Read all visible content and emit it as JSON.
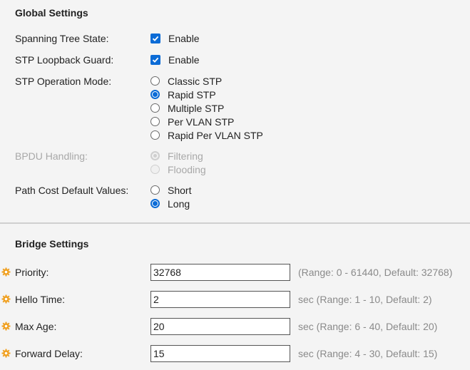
{
  "global_settings": {
    "title": "Global Settings",
    "spanning_tree_state": {
      "label": "Spanning Tree State:",
      "option": "Enable",
      "checked": true
    },
    "stp_loopback_guard": {
      "label": "STP Loopback Guard:",
      "option": "Enable",
      "checked": true
    },
    "stp_operation_mode": {
      "label": "STP Operation Mode:",
      "options": [
        "Classic STP",
        "Rapid STP",
        "Multiple STP",
        "Per VLAN STP",
        "Rapid Per VLAN STP"
      ],
      "selected": "Rapid STP"
    },
    "bpdu_handling": {
      "label": "BPDU Handling:",
      "options": [
        "Filtering",
        "Flooding"
      ],
      "selected": "Filtering",
      "disabled": true
    },
    "path_cost_default_values": {
      "label": "Path Cost Default Values:",
      "options": [
        "Short",
        "Long"
      ],
      "selected": "Long"
    }
  },
  "bridge_settings": {
    "title": "Bridge Settings",
    "fields": [
      {
        "label": "Priority:",
        "value": "32768",
        "hint": "(Range: 0 - 61440, Default: 32768)"
      },
      {
        "label": "Hello Time:",
        "value": "2",
        "hint": "sec (Range: 1 - 10, Default: 2)"
      },
      {
        "label": "Max Age:",
        "value": "20",
        "hint": "sec (Range: 6 - 40, Default: 20)"
      },
      {
        "label": "Forward Delay:",
        "value": "15",
        "hint": "sec (Range: 4 - 30, Default: 15)"
      }
    ]
  },
  "colors": {
    "accent": "#0b6bd6",
    "required_icon": "#f0a020",
    "hint_text": "#8a8a8a",
    "disabled_text": "#a8a8a8"
  }
}
